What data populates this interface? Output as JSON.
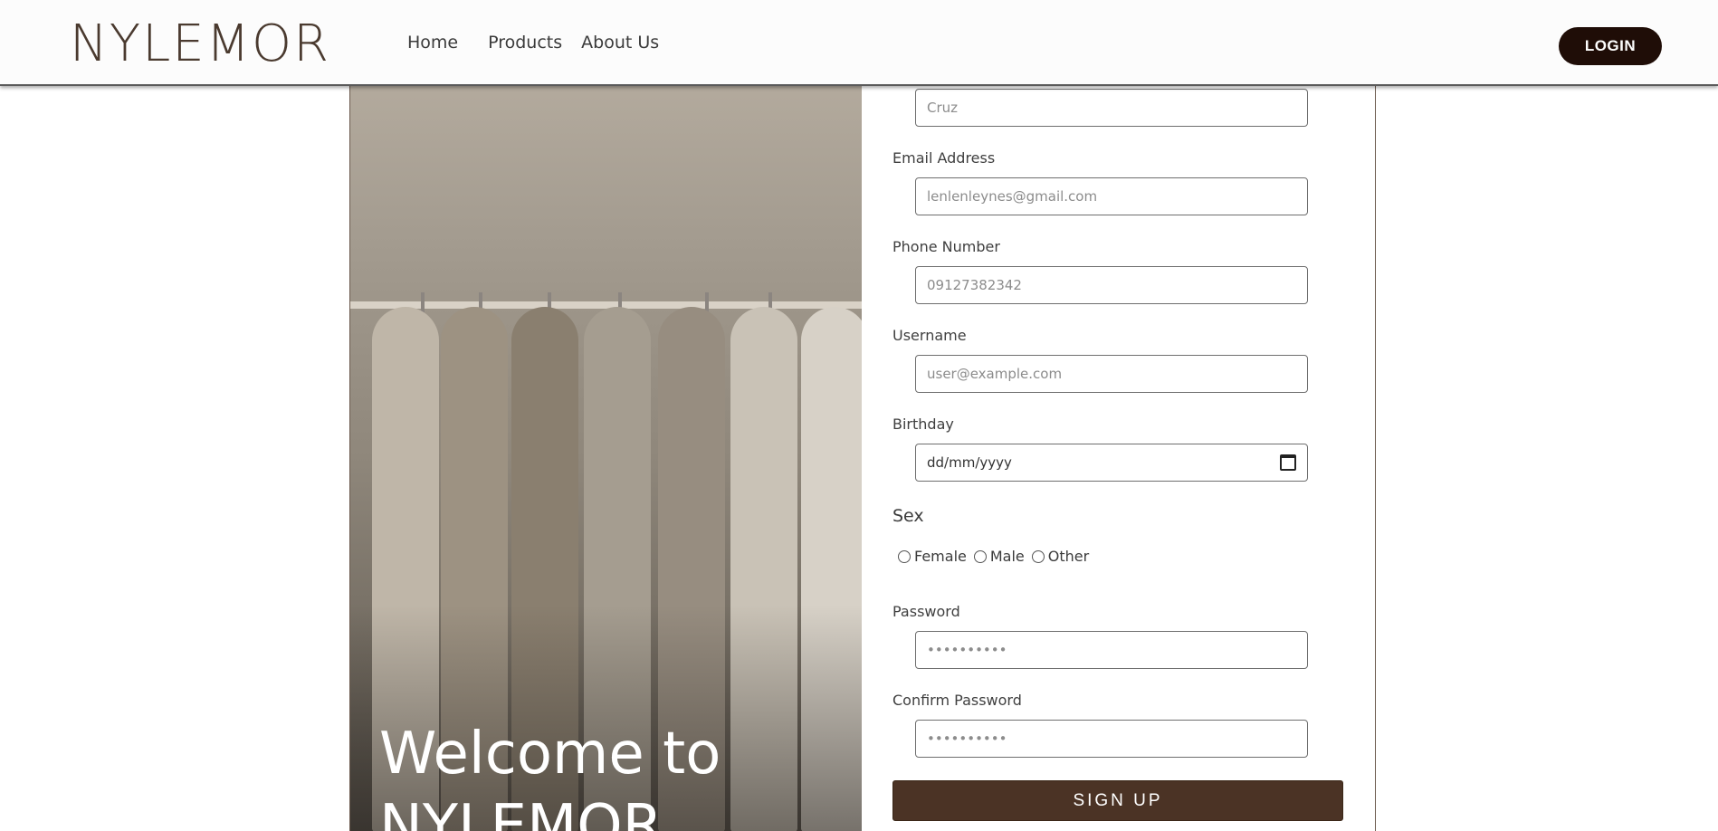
{
  "navbar": {
    "logo": "NYLEMOR",
    "links": [
      "Home",
      "Products",
      "About Us"
    ],
    "login_label": "LOGIN"
  },
  "hero": {
    "welcome_line1": "Welcome to",
    "welcome_line2": "NYLEMOR"
  },
  "form": {
    "last_name": {
      "placeholder": "Cruz"
    },
    "email": {
      "label": "Email Address",
      "placeholder": "lenlenleynes@gmail.com"
    },
    "phone": {
      "label": "Phone Number",
      "placeholder": "09127382342"
    },
    "username": {
      "label": "Username",
      "placeholder": "user@example.com"
    },
    "birthday": {
      "label": "Birthday",
      "placeholder": "dd/mm/yyyy"
    },
    "sex": {
      "label": "Sex",
      "options": [
        "Female",
        "Male",
        "Other"
      ]
    },
    "password": {
      "label": "Password",
      "placeholder": "••••••••••"
    },
    "confirm_password": {
      "label": "Confirm Password",
      "placeholder": "••••••••••"
    },
    "submit_label": "SIGN UP"
  },
  "colors": {
    "brand": "#4a3a2f",
    "button_primary": "#4b3325",
    "login_bg": "#1f0d07"
  }
}
